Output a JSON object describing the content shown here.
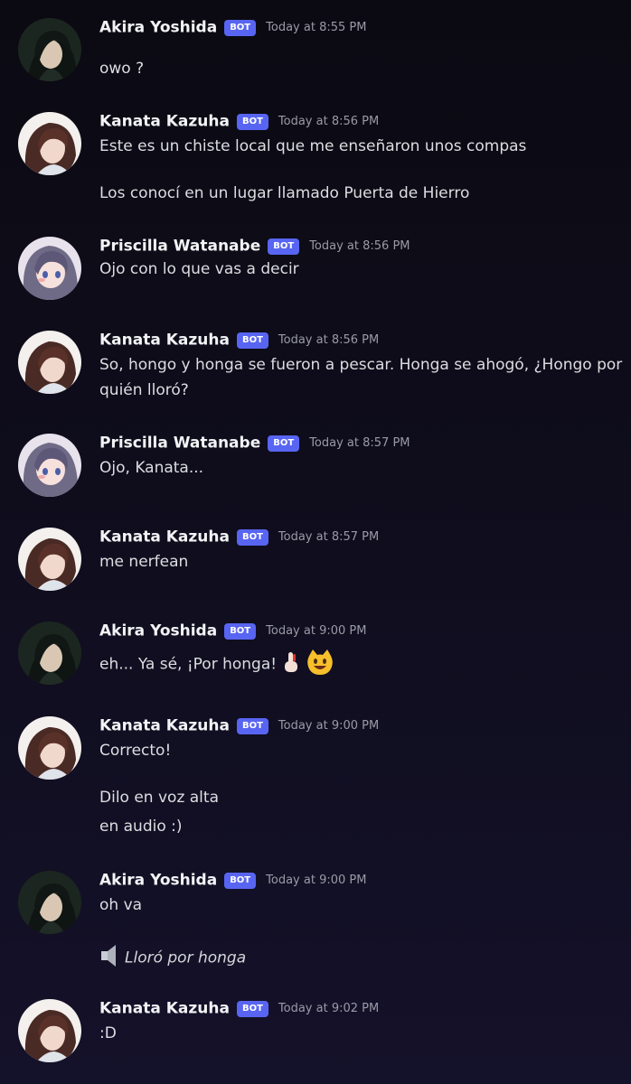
{
  "badge": "BOT",
  "colors": {
    "accent": "#5865f2",
    "timestamp": "#9a9aa6",
    "text": "#dcdde1",
    "background": "#0e0c18"
  },
  "messages": [
    {
      "author": "Akira Yoshida",
      "time": "Today at 8:55 PM",
      "avatar": "akira-avatar",
      "lines": [
        "owo ?"
      ]
    },
    {
      "author": "Kanata Kazuha",
      "time": "Today at 8:56 PM",
      "avatar": "kanata-avatar",
      "lines": [
        "Este es un chiste local que me enseñaron unos compas",
        "Los conocí en un lugar llamado Puerta de Hierro"
      ]
    },
    {
      "author": "Priscilla Watanabe",
      "time": "Today at 8:56 PM",
      "avatar": "priscilla-avatar",
      "lines": [
        "Ojo con lo que vas a decir"
      ]
    },
    {
      "author": "Kanata Kazuha",
      "time": "Today at 8:56 PM",
      "avatar": "kanata-avatar",
      "lines": [
        "So, hongo y honga se fueron a pescar. Honga se ahogó, ¿Hongo por",
        "quién lloró?"
      ]
    },
    {
      "author": "Priscilla Watanabe",
      "time": "Today at 8:57 PM",
      "avatar": "priscilla-avatar",
      "lines": [
        "Ojo, Kanata..."
      ]
    },
    {
      "author": "Kanata Kazuha",
      "time": "Today at 8:57 PM",
      "avatar": "kanata-avatar",
      "lines": [
        "me nerfean"
      ]
    },
    {
      "author": "Akira Yoshida",
      "time": "Today at 9:00 PM",
      "avatar": "akira-avatar",
      "lines": [
        "eh... Ya sé, ¡Por honga!"
      ],
      "emojis": [
        "index-finger-up-emoji",
        "grinning-cat-emoji"
      ]
    },
    {
      "author": "Kanata Kazuha",
      "time": "Today at 9:00 PM",
      "avatar": "kanata-avatar",
      "lines": [
        "Correcto!",
        "Dilo en voz alta",
        "en audio :)"
      ]
    },
    {
      "author": "Akira Yoshida",
      "time": "Today at 9:00 PM",
      "avatar": "akira-avatar",
      "lines": [
        "oh va"
      ],
      "audio": "Lloró por honga"
    },
    {
      "author": "Kanata Kazuha",
      "time": "Today at 9:02 PM",
      "avatar": "kanata-avatar",
      "lines": [
        ":D"
      ]
    }
  ]
}
